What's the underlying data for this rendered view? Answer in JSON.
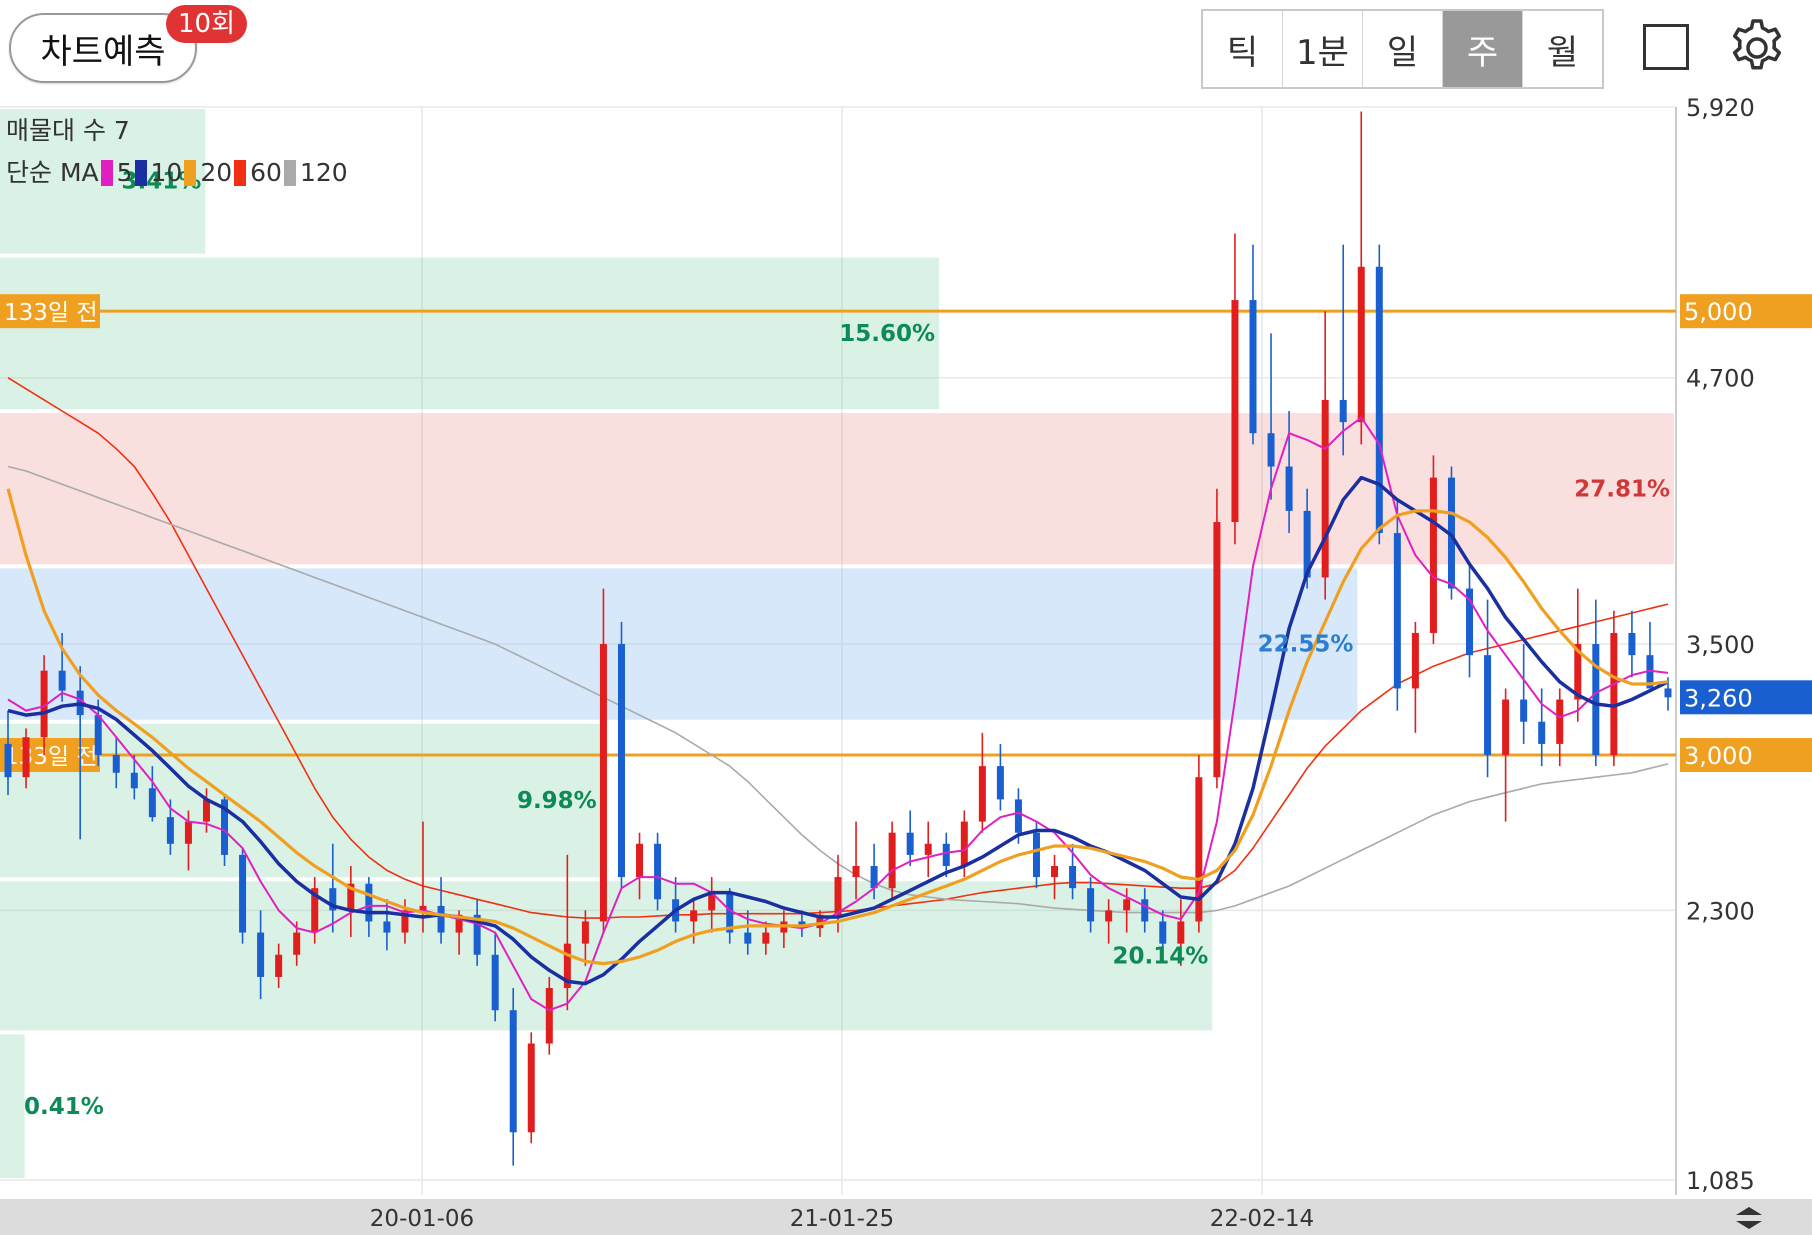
{
  "header": {
    "predict_label": "차트예측",
    "predict_count": "10회",
    "periods": [
      "틱",
      "1분",
      "일",
      "주",
      "월"
    ],
    "active_period": "주",
    "square_icon": "square-icon",
    "settings_icon": "gear-icon"
  },
  "legend": {
    "volume_profile_label": "매물대 수 7",
    "ma_label": "단순 MA",
    "ma_periods": [
      "5",
      "10",
      "20",
      "60",
      "120"
    ],
    "ma_colors": [
      "#e020c0",
      "#1a2fa0",
      "#f0a020",
      "#f03010",
      "#aaaaaa"
    ]
  },
  "chart_data": {
    "type": "candlestick",
    "y_axis": {
      "min": 1085,
      "max": 5920,
      "tick_labels": [
        "5,920",
        "4,700",
        "3,500",
        "2,300",
        "1,085"
      ],
      "tick_values": [
        5920,
        4700,
        3500,
        2300,
        1085
      ]
    },
    "x_axis": {
      "tick_labels": [
        "20-01-06",
        "21-01-25",
        "22-02-14"
      ]
    },
    "current_price": {
      "value": 3260,
      "label": "3,260",
      "color": "#1a5fd0"
    },
    "horizontal_lines": [
      {
        "value": 5000,
        "price_label": "5,000",
        "tag": "133일 전",
        "color": "#f0a020"
      },
      {
        "value": 3000,
        "price_label": "3,000",
        "tag": "133일 전",
        "color": "#f0a020"
      }
    ],
    "volume_profile": [
      {
        "low": 1085,
        "high": 1750,
        "pct": "0.41%",
        "color": "green"
      },
      {
        "low": 1750,
        "high": 2440,
        "pct": "20.14%",
        "color": "green"
      },
      {
        "low": 2440,
        "high": 3150,
        "pct": "9.98%",
        "color": "green"
      },
      {
        "low": 3150,
        "high": 3850,
        "pct": "22.55%",
        "color": "blue"
      },
      {
        "low": 3850,
        "high": 4550,
        "pct": "27.81%",
        "color": "red"
      },
      {
        "low": 4550,
        "high": 5250,
        "pct": "15.60%",
        "color": "green"
      },
      {
        "low": 5250,
        "high": 5920,
        "pct": "3.41%",
        "color": "green"
      }
    ],
    "ohlc": [
      [
        3050,
        3200,
        2820,
        2900
      ],
      [
        2900,
        3120,
        2850,
        3080
      ],
      [
        3080,
        3450,
        3000,
        3380
      ],
      [
        3380,
        3550,
        3240,
        3290
      ],
      [
        3290,
        3400,
        2620,
        3180
      ],
      [
        3180,
        3250,
        2950,
        3000
      ],
      [
        3000,
        3080,
        2850,
        2920
      ],
      [
        2920,
        3000,
        2800,
        2850
      ],
      [
        2850,
        2950,
        2700,
        2720
      ],
      [
        2720,
        2800,
        2550,
        2600
      ],
      [
        2600,
        2750,
        2480,
        2700
      ],
      [
        2700,
        2850,
        2650,
        2800
      ],
      [
        2800,
        2820,
        2500,
        2550
      ],
      [
        2550,
        2580,
        2150,
        2200
      ],
      [
        2200,
        2300,
        1900,
        2000
      ],
      [
        2000,
        2150,
        1950,
        2100
      ],
      [
        2100,
        2250,
        2050,
        2200
      ],
      [
        2200,
        2450,
        2150,
        2400
      ],
      [
        2400,
        2600,
        2200,
        2300
      ],
      [
        2300,
        2500,
        2180,
        2420
      ],
      [
        2420,
        2450,
        2180,
        2250
      ],
      [
        2250,
        2350,
        2120,
        2200
      ],
      [
        2200,
        2350,
        2150,
        2300
      ],
      [
        2300,
        2700,
        2200,
        2320
      ],
      [
        2320,
        2450,
        2150,
        2200
      ],
      [
        2200,
        2300,
        2100,
        2280
      ],
      [
        2280,
        2350,
        2050,
        2100
      ],
      [
        2100,
        2200,
        1800,
        1850
      ],
      [
        1850,
        1950,
        1150,
        1300
      ],
      [
        1300,
        1750,
        1250,
        1700
      ],
      [
        1700,
        2000,
        1650,
        1950
      ],
      [
        1950,
        2550,
        1850,
        2150
      ],
      [
        2150,
        2300,
        2050,
        2250
      ],
      [
        2250,
        3750,
        2200,
        3500
      ],
      [
        3500,
        3600,
        2400,
        2450
      ],
      [
        2450,
        2650,
        2350,
        2600
      ],
      [
        2600,
        2650,
        2300,
        2350
      ],
      [
        2350,
        2450,
        2200,
        2250
      ],
      [
        2250,
        2350,
        2150,
        2300
      ],
      [
        2300,
        2450,
        2200,
        2380
      ],
      [
        2380,
        2400,
        2150,
        2200
      ],
      [
        2200,
        2300,
        2100,
        2150
      ],
      [
        2150,
        2250,
        2100,
        2200
      ],
      [
        2200,
        2300,
        2130,
        2250
      ],
      [
        2250,
        2300,
        2180,
        2220
      ],
      [
        2220,
        2300,
        2180,
        2280
      ],
      [
        2280,
        2550,
        2200,
        2450
      ],
      [
        2450,
        2700,
        2350,
        2500
      ],
      [
        2500,
        2600,
        2350,
        2400
      ],
      [
        2400,
        2700,
        2350,
        2650
      ],
      [
        2650,
        2750,
        2500,
        2550
      ],
      [
        2550,
        2700,
        2450,
        2600
      ],
      [
        2600,
        2650,
        2450,
        2500
      ],
      [
        2500,
        2750,
        2450,
        2700
      ],
      [
        2700,
        3100,
        2650,
        2950
      ],
      [
        2950,
        3050,
        2750,
        2800
      ],
      [
        2800,
        2850,
        2600,
        2650
      ],
      [
        2650,
        2700,
        2400,
        2450
      ],
      [
        2450,
        2550,
        2350,
        2500
      ],
      [
        2500,
        2600,
        2350,
        2400
      ],
      [
        2400,
        2450,
        2200,
        2250
      ],
      [
        2250,
        2350,
        2150,
        2300
      ],
      [
        2300,
        2400,
        2200,
        2350
      ],
      [
        2350,
        2400,
        2200,
        2250
      ],
      [
        2250,
        2300,
        2100,
        2150
      ],
      [
        2150,
        2350,
        2050,
        2250
      ],
      [
        2250,
        3000,
        2200,
        2900
      ],
      [
        2900,
        4200,
        2850,
        4050
      ],
      [
        4050,
        5350,
        3950,
        5050
      ],
      [
        5050,
        5300,
        4400,
        4450
      ],
      [
        4450,
        4900,
        4150,
        4300
      ],
      [
        4300,
        4550,
        4000,
        4100
      ],
      [
        4100,
        4200,
        3750,
        3800
      ],
      [
        3800,
        5000,
        3700,
        4600
      ],
      [
        4600,
        5300,
        4350,
        4500
      ],
      [
        4500,
        5900,
        4400,
        5200
      ],
      [
        5200,
        5300,
        3950,
        4000
      ],
      [
        4000,
        4150,
        3200,
        3300
      ],
      [
        3300,
        3600,
        3100,
        3550
      ],
      [
        3550,
        4350,
        3500,
        4250
      ],
      [
        4250,
        4300,
        3700,
        3750
      ],
      [
        3750,
        3850,
        3350,
        3450
      ],
      [
        3450,
        3700,
        2900,
        3000
      ],
      [
        3000,
        3300,
        2700,
        3250
      ],
      [
        3250,
        3500,
        3050,
        3150
      ],
      [
        3150,
        3300,
        2950,
        3050
      ],
      [
        3050,
        3300,
        2950,
        3250
      ],
      [
        3250,
        3750,
        3150,
        3500
      ],
      [
        3500,
        3700,
        2950,
        3000
      ],
      [
        3000,
        3650,
        2950,
        3550
      ],
      [
        3550,
        3650,
        3350,
        3450
      ],
      [
        3450,
        3600,
        3300,
        3300
      ],
      [
        3300,
        3350,
        3200,
        3260
      ]
    ],
    "ma": [
      {
        "period": 5,
        "color": "#e020c0",
        "values": [
          3250,
          3200,
          3220,
          3280,
          3250,
          3180,
          3080,
          2980,
          2880,
          2760,
          2700,
          2690,
          2660,
          2580,
          2430,
          2300,
          2220,
          2200,
          2240,
          2290,
          2320,
          2320,
          2290,
          2300,
          2280,
          2260,
          2240,
          2200,
          2050,
          1900,
          1850,
          1880,
          1980,
          2200,
          2400,
          2450,
          2450,
          2420,
          2420,
          2380,
          2300,
          2260,
          2240,
          2230,
          2220,
          2240,
          2290,
          2340,
          2400,
          2480,
          2520,
          2540,
          2560,
          2570,
          2660,
          2720,
          2740,
          2700,
          2650,
          2560,
          2460,
          2400,
          2360,
          2320,
          2280,
          2260,
          2380,
          2700,
          3250,
          3850,
          4200,
          4450,
          4420,
          4380,
          4460,
          4520,
          4400,
          4080,
          3900,
          3800,
          3770,
          3700,
          3560,
          3450,
          3340,
          3230,
          3170,
          3200,
          3280,
          3320,
          3360,
          3380,
          3370
        ]
      },
      {
        "period": 10,
        "color": "#1a2fa0",
        "values": [
          3200,
          3180,
          3190,
          3220,
          3230,
          3210,
          3160,
          3090,
          3020,
          2940,
          2860,
          2800,
          2760,
          2700,
          2610,
          2510,
          2430,
          2370,
          2320,
          2300,
          2290,
          2290,
          2280,
          2270,
          2280,
          2270,
          2250,
          2230,
          2170,
          2090,
          2030,
          1980,
          1970,
          2010,
          2080,
          2160,
          2230,
          2300,
          2350,
          2380,
          2380,
          2360,
          2340,
          2310,
          2290,
          2270,
          2270,
          2290,
          2310,
          2350,
          2390,
          2430,
          2470,
          2500,
          2540,
          2590,
          2640,
          2660,
          2660,
          2630,
          2590,
          2560,
          2520,
          2480,
          2420,
          2360,
          2350,
          2430,
          2600,
          2850,
          3200,
          3570,
          3820,
          3980,
          4150,
          4250,
          4220,
          4150,
          4100,
          4050,
          3990,
          3860,
          3750,
          3620,
          3520,
          3420,
          3330,
          3270,
          3230,
          3220,
          3250,
          3290,
          3330
        ]
      },
      {
        "period": 20,
        "color": "#f0a020",
        "values": [
          4200,
          3900,
          3650,
          3480,
          3360,
          3270,
          3200,
          3140,
          3080,
          3010,
          2940,
          2880,
          2820,
          2760,
          2700,
          2630,
          2560,
          2500,
          2450,
          2400,
          2370,
          2340,
          2310,
          2290,
          2280,
          2270,
          2260,
          2250,
          2220,
          2180,
          2140,
          2100,
          2070,
          2060,
          2070,
          2090,
          2120,
          2160,
          2190,
          2210,
          2220,
          2230,
          2230,
          2230,
          2230,
          2240,
          2250,
          2270,
          2290,
          2320,
          2350,
          2380,
          2410,
          2440,
          2480,
          2520,
          2550,
          2570,
          2590,
          2590,
          2580,
          2560,
          2540,
          2520,
          2490,
          2450,
          2440,
          2480,
          2570,
          2730,
          2950,
          3200,
          3420,
          3600,
          3780,
          3930,
          4020,
          4080,
          4100,
          4100,
          4090,
          4050,
          3980,
          3890,
          3780,
          3660,
          3560,
          3470,
          3400,
          3350,
          3320,
          3320,
          3330
        ]
      },
      {
        "period": 60,
        "color": "#f03010",
        "values": [
          4700,
          4650,
          4600,
          4550,
          4500,
          4450,
          4380,
          4300,
          4180,
          4050,
          3900,
          3750,
          3600,
          3450,
          3300,
          3150,
          3000,
          2850,
          2720,
          2620,
          2540,
          2480,
          2440,
          2410,
          2390,
          2370,
          2350,
          2330,
          2310,
          2290,
          2280,
          2270,
          2265,
          2265,
          2270,
          2270,
          2275,
          2280,
          2280,
          2285,
          2285,
          2285,
          2285,
          2285,
          2285,
          2290,
          2295,
          2300,
          2310,
          2320,
          2330,
          2340,
          2350,
          2365,
          2380,
          2390,
          2400,
          2410,
          2420,
          2425,
          2425,
          2420,
          2415,
          2410,
          2405,
          2400,
          2400,
          2420,
          2480,
          2580,
          2700,
          2820,
          2940,
          3040,
          3120,
          3200,
          3260,
          3320,
          3360,
          3400,
          3430,
          3460,
          3480,
          3500,
          3520,
          3540,
          3560,
          3580,
          3600,
          3620,
          3640,
          3660,
          3680
        ]
      },
      {
        "period": 120,
        "color": "#aaaaaa",
        "values": [
          4300,
          4280,
          4250,
          4220,
          4190,
          4160,
          4130,
          4100,
          4070,
          4040,
          4010,
          3980,
          3950,
          3920,
          3890,
          3860,
          3830,
          3800,
          3770,
          3740,
          3710,
          3680,
          3650,
          3620,
          3590,
          3560,
          3530,
          3500,
          3460,
          3420,
          3380,
          3340,
          3300,
          3260,
          3220,
          3180,
          3140,
          3100,
          3050,
          3000,
          2950,
          2880,
          2800,
          2720,
          2640,
          2570,
          2510,
          2460,
          2420,
          2390,
          2370,
          2360,
          2350,
          2345,
          2340,
          2335,
          2330,
          2320,
          2310,
          2305,
          2300,
          2295,
          2290,
          2290,
          2290,
          2290,
          2290,
          2300,
          2320,
          2350,
          2380,
          2410,
          2450,
          2490,
          2530,
          2570,
          2610,
          2650,
          2690,
          2730,
          2760,
          2790,
          2810,
          2830,
          2850,
          2870,
          2880,
          2890,
          2900,
          2910,
          2920,
          2940,
          2960
        ]
      }
    ]
  }
}
